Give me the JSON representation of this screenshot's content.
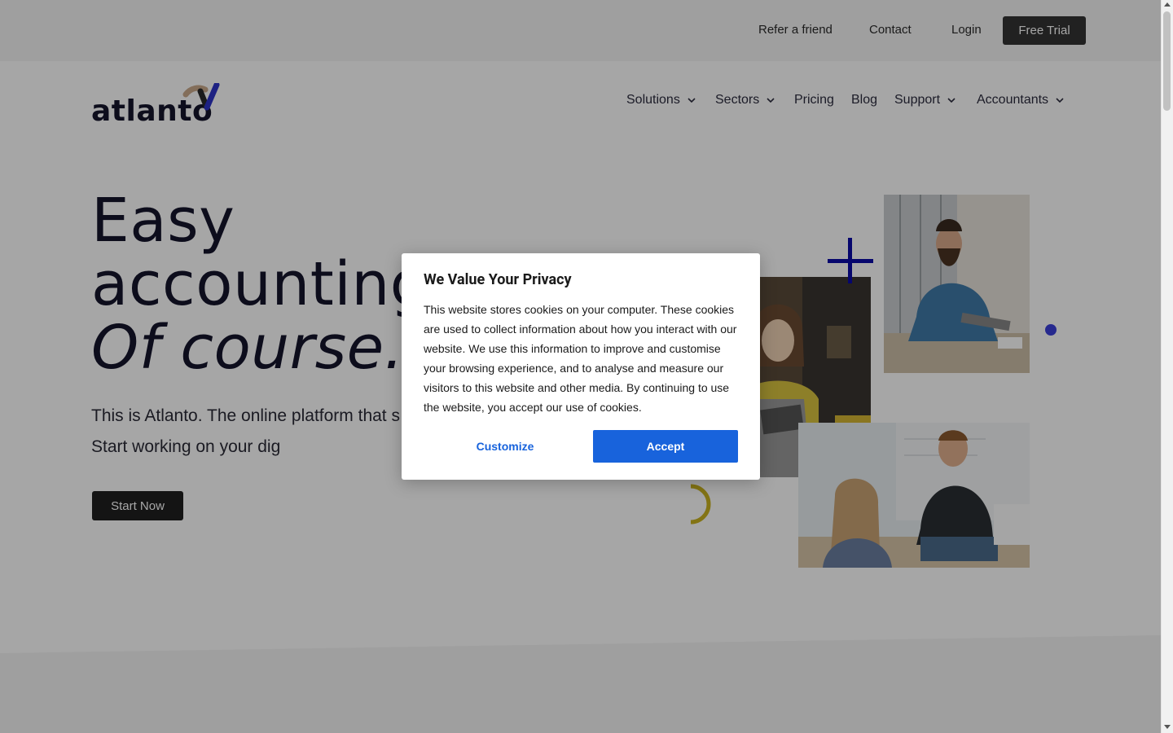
{
  "topbar": {
    "links": [
      "Refer a friend",
      "Contact",
      "Login"
    ],
    "cta": "Free Trial"
  },
  "logo": {
    "text": "atlanto"
  },
  "nav": {
    "items": [
      {
        "label": "Solutions",
        "dropdown": true
      },
      {
        "label": "Sectors",
        "dropdown": true
      },
      {
        "label": "Pricing",
        "dropdown": false
      },
      {
        "label": "Blog",
        "dropdown": false
      },
      {
        "label": "Support",
        "dropdown": true
      },
      {
        "label": "Accountants",
        "dropdown": true
      }
    ]
  },
  "hero": {
    "line1": "Easy",
    "line2": "accounting",
    "line3": "Of course.",
    "subtitle": "This is Atlanto. The online platform that s administration. Start working on your dig",
    "cta": "Start Now"
  },
  "cookie": {
    "title": "We Value Your Privacy",
    "body": "This website stores cookies on your computer. These cookies are used to collect information about how you interact with our website. We use this information to improve and customise your browsing experience, and to analyse and measure our visitors to this website and other media. By continuing to use the website, you accept our use of cookies.",
    "customize": "Customize",
    "accept": "Accept"
  },
  "colors": {
    "accent_blue": "#1863dc",
    "plus_navy": "#0a0aa8",
    "dot_indigo": "#3b3fdb",
    "arc_yellow": "#c9b220",
    "dark_button": "#1f1f1f"
  },
  "icons": {
    "chevron": "chevron-down-icon",
    "plus": "plus-icon",
    "dot": "dot-icon",
    "arc": "arc-icon"
  }
}
